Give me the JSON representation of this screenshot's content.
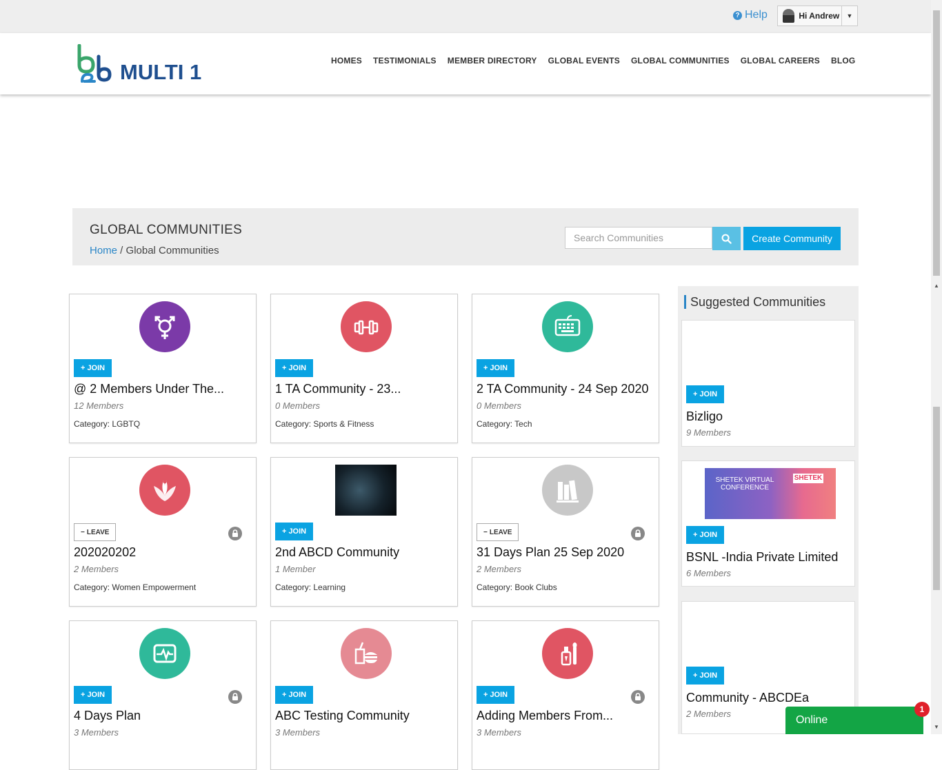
{
  "topbar": {
    "help_label": "Help",
    "user_greeting": "Hi Andrew"
  },
  "logo": {
    "mark": "b2b",
    "text": "MULTI 1"
  },
  "nav": [
    "HOMES",
    "TESTIMONIALS",
    "MEMBER DIRECTORY",
    "GLOBAL EVENTS",
    "GLOBAL COMMUNITIES",
    "GLOBAL CAREERS",
    "BLOG"
  ],
  "page": {
    "title": "GLOBAL COMMUNITIES",
    "breadcrumb_home": "Home",
    "breadcrumb_sep": " / ",
    "breadcrumb_current": "Global Communities",
    "search_placeholder": "Search Communities",
    "create_label": "Create Community"
  },
  "labels": {
    "join": "JOIN",
    "leave": "LEAVE",
    "join_icon": "+",
    "leave_icon": "−"
  },
  "communities": [
    {
      "title": "@ 2 Members Under The...",
      "members": "12 Members",
      "category": "Category: LGBTQ",
      "action": "join",
      "icon": "gender-icon",
      "color": "#7b3aa8",
      "locked": false
    },
    {
      "title": "1 TA Community - 23...",
      "members": "0 Members",
      "category": "Category: Sports & Fitness",
      "action": "join",
      "icon": "dumbbell-icon",
      "color": "#e05563",
      "locked": false
    },
    {
      "title": "2 TA Community - 24 Sep 2020",
      "members": "0 Members",
      "category": "Category: Tech",
      "action": "join",
      "icon": "keyboard-icon",
      "color": "#2fb99a",
      "locked": false
    },
    {
      "title": "202020202",
      "members": "2 Members",
      "category": "Category: Women Empowerment",
      "action": "leave",
      "icon": "lotus-icon",
      "color": "#e05563",
      "locked": true
    },
    {
      "title": "2nd ABCD Community",
      "members": "1 Member",
      "category": "Category: Learning",
      "action": "join",
      "icon": "photo",
      "color": "#15222b",
      "locked": false
    },
    {
      "title": "31 Days Plan 25 Sep 2020",
      "members": "2 Members",
      "category": "Category: Book Clubs",
      "action": "leave",
      "icon": "books-icon",
      "color": "#c8c8c8",
      "locked": true
    },
    {
      "title": "4 Days Plan",
      "members": "3 Members",
      "category": "",
      "action": "join",
      "icon": "heartbeat-icon",
      "color": "#2fb99a",
      "locked": true
    },
    {
      "title": "ABC Testing Community",
      "members": "3 Members",
      "category": "",
      "action": "join",
      "icon": "food-icon",
      "color": "#e58a93",
      "locked": false
    },
    {
      "title": "Adding Members From...",
      "members": "3 Members",
      "category": "",
      "action": "join",
      "icon": "cosmetics-icon",
      "color": "#e05563",
      "locked": true
    }
  ],
  "sidebar": {
    "title": "Suggested Communities",
    "items": [
      {
        "title": "Bizligo",
        "members": "9 Members"
      },
      {
        "title": "BSNL -India Private Limited",
        "members": "6 Members",
        "banner_left": "SHETEK VIRTUAL CONFERENCE",
        "banner_right": "SHETEK"
      },
      {
        "title": "Community - ABCDEa",
        "members": "2 Members"
      }
    ]
  },
  "chat": {
    "label": "Online",
    "badge": "1"
  }
}
